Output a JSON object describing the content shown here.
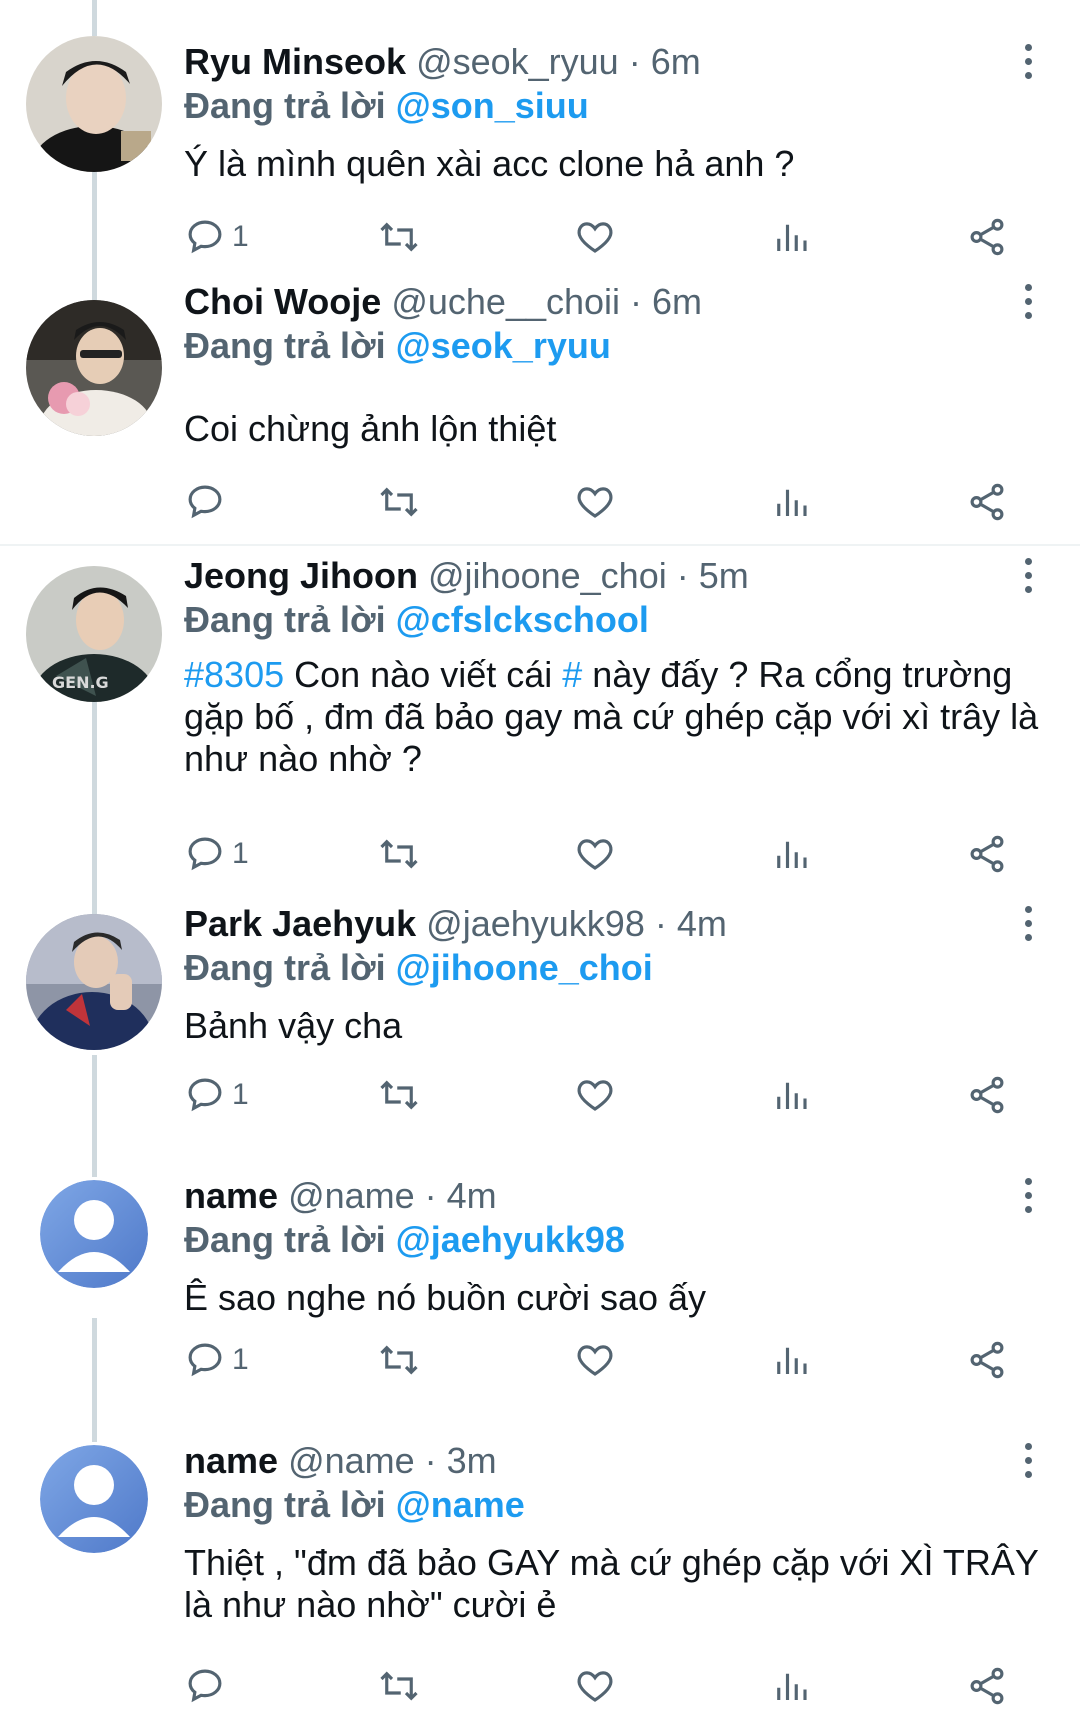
{
  "tweets": [
    {
      "name": "Ryu Minseok",
      "meta": "@seok_ryuu · 6m",
      "reply_prefix": "Đang trả lời",
      "reply_to": "@son_siuu",
      "body": "Ý là mình quên xài acc clone hả anh ?",
      "reply_count": "1"
    },
    {
      "name": "Choi Wooje",
      "meta": "@uche__choii · 6m",
      "reply_prefix": "Đang trả lời",
      "reply_to": "@seok_ryuu",
      "body": "Coi chừng ảnh lộn thiệt",
      "reply_count": ""
    },
    {
      "name": "Jeong Jihoon",
      "meta": "@jihoone_choi · 5m",
      "reply_prefix": "Đang trả lời",
      "reply_to": "@cfslckschool",
      "body_hash1": "#8305",
      "body_part1": " Con nào viết cái ",
      "body_hash2": "#",
      "body_part2": " này đấy ? Ra cổng trường gặp bố , đm đã bảo gay mà cứ ghép cặp với xì trây là như nào nhờ ?",
      "reply_count": "1"
    },
    {
      "name": "Park Jaehyuk",
      "meta": "@jaehyukk98 · 4m",
      "reply_prefix": "Đang trả lời",
      "reply_to": "@jihoone_choi",
      "body": "Bảnh vậy cha",
      "reply_count": "1"
    },
    {
      "name": "name",
      "meta": "@name · 4m",
      "reply_prefix": "Đang trả lời",
      "reply_to": "@jaehyukk98",
      "body": "Ê sao nghe nó buồn cười sao ấy",
      "reply_count": "1"
    },
    {
      "name": "name",
      "meta": "@name · 3m",
      "reply_prefix": "Đang trả lời",
      "reply_to": "@name",
      "body": "Thiệt , \"đm đã bảo GAY mà cứ ghép cặp với XÌ TRÂY là như nào nhờ\" cười ẻ",
      "reply_count": ""
    }
  ],
  "icons": {
    "reply": "speech-bubble-icon",
    "retweet": "retweet-icon",
    "like": "heart-icon",
    "views": "bar-chart-icon",
    "share": "share-icon",
    "more": "vertical-dots-icon"
  },
  "colors": {
    "accent": "#1d9bf0",
    "muted": "#536471",
    "text": "#0f1419",
    "thread_line": "#cfd9de"
  }
}
